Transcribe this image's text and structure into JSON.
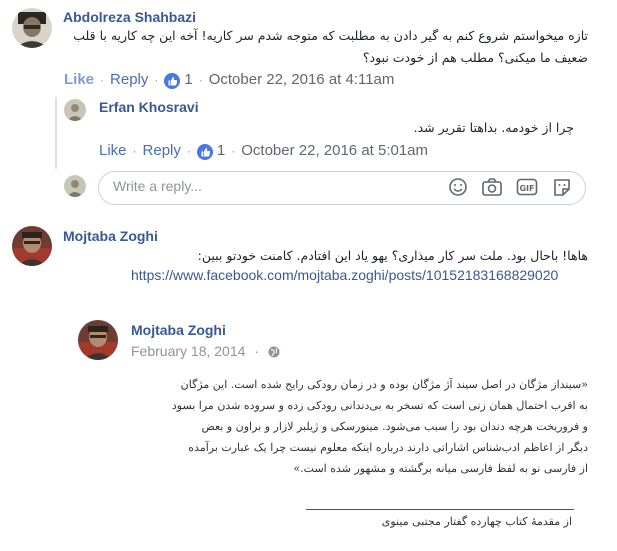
{
  "comment1": {
    "author": "Abdolreza Shahbazi",
    "text": "تازه میخواستم شروع کنم به گیر دادن به مطلبت که متوجه شدم سر کاریه! آخه این چه کاریه با قلب ضعیف ما میکنی؟ مطلب هم از خودت نبود؟",
    "like": "Like",
    "reply": "Reply",
    "like_count": "1",
    "timestamp": "October 22, 2016 at 4:11am"
  },
  "reply1": {
    "author": "Erfan Khosravi",
    "text": "چرا از خودمه. بداهتا تقریر شد.",
    "like": "Like",
    "reply": "Reply",
    "like_count": "1",
    "timestamp": "October 22, 2016 at 5:01am"
  },
  "reply_box": {
    "placeholder": "Write a reply...",
    "icons": [
      "emoji-icon",
      "camera-icon",
      "gif-icon",
      "sticker-icon"
    ]
  },
  "comment2": {
    "author": "Mojtaba Zoghi",
    "text": "هاها! باحال بود. ملت سر کار میذاری؟ یهو یاد این افتادم. کامنت خودتو ببین:",
    "link": "https://www.facebook.com/mojtaba.zoghi/posts/10152183168829020"
  },
  "shared_post": {
    "author": "Mojtaba Zoghi",
    "date": "February 18, 2014",
    "audience_icon": "globe-icon",
    "quote_lines": [
      "«سینداز مژگان در اصل سیند آژ مژگان بوده و در زمان رودکی رایج شده است. این مژگان",
      "به اقرب احتمال همان زنی است که تسخر به بی‌دندانی رودکی زده و سروده شدن مرا بسود",
      "و فروریخت هرچه دندان بود را سبب می‌شود. مینورسکی و ژیلبر لازار و براون و بعض",
      "دیگر از اعاظم ادب‌شناس اشاراتی دارند درباره اینکه معلوم نیست چرا یک عبارت برآمده",
      "از فارسی نو به لفظ فارسی میانه برگشته و مشهور شده است.»"
    ],
    "source": "از مقدمهٔ کتاب چهارده گفتار مجتبی مینوی"
  }
}
